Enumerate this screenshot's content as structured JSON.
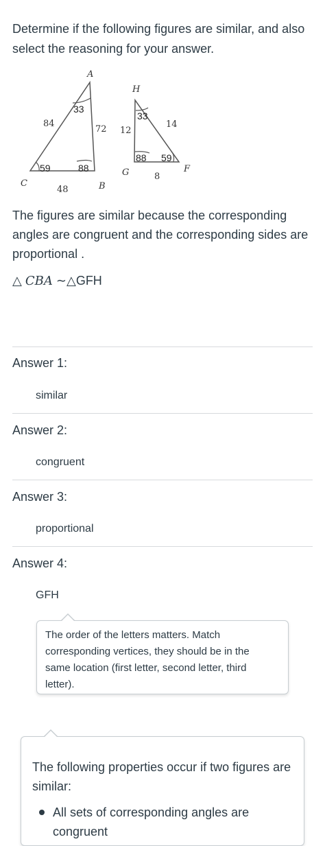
{
  "question": {
    "text": "Determine if the following figures are similar, and also select the reasoning for your answer."
  },
  "figure": {
    "triangle1": {
      "vertices": {
        "A": "A",
        "B": "B",
        "C": "C"
      },
      "angles": {
        "A": "33",
        "B": "88",
        "C": "59"
      },
      "sides": {
        "CA": "84",
        "AB": "72",
        "CB": "48"
      }
    },
    "triangle2": {
      "vertices": {
        "H": "H",
        "G": "G",
        "F": "F"
      },
      "angles": {
        "H": "33",
        "G": "88",
        "F": "59"
      },
      "sides": {
        "HG": "12",
        "HF": "14",
        "GF": "8"
      }
    }
  },
  "explanation": {
    "text": "The figures are similar because the corresponding angles are congruent and the corresponding sides are proportional ."
  },
  "similarity": {
    "triangle_symbol": "△",
    "left": "CBA",
    "relation": "∼△",
    "right": "GFH"
  },
  "answers": [
    {
      "label": "Answer 1:",
      "value": "similar"
    },
    {
      "label": "Answer 2:",
      "value": "congruent"
    },
    {
      "label": "Answer 3:",
      "value": "proportional"
    },
    {
      "label": "Answer 4:",
      "value": "GFH"
    }
  ],
  "tooltip": {
    "text": "The order of the letters matters. Match corresponding vertices, they should be in the same location (first letter, second letter, third letter)."
  },
  "info_box": {
    "title": "The following properties occur if two figures are similar:",
    "bullet": "All sets of corresponding angles are congruent"
  }
}
